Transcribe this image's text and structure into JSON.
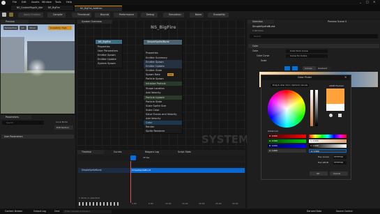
{
  "menu_bar": {
    "items": [
      "File",
      "Edit",
      "Assets",
      "Window",
      "Tools",
      "Help"
    ],
    "tabs": [
      "NS_CustomMsgvfx_Addit",
      "NS_BigFire",
      "NS_BigFire_Addition"
    ],
    "window_controls": [
      "_",
      "□",
      "×"
    ]
  },
  "toolbar": {
    "items": [
      "Save",
      "Browse",
      "Apply Emitters",
      "Compile",
      "Thumbnail",
      "Bounds",
      "Performance",
      "Debug",
      "Simulation",
      "Baker",
      "Scalability"
    ]
  },
  "preview": {
    "tab": "Preview",
    "buttons": [
      "Perspective",
      "Lit",
      "Show",
      "Scalability: High"
    ]
  },
  "system_overview": {
    "tab": "System Overview",
    "title": "NS_BigFire",
    "watermark": "SYSTEM",
    "system_node": {
      "title": "NS_BigFire",
      "rows": [
        "Properties",
        "User Parameters",
        "Emitter Spawn",
        "Emitter Update",
        "System Spawn",
        "System State"
      ]
    },
    "emitter_node": {
      "title": "SimpleSprite/Burst",
      "rows": [
        "Properties",
        "Emitter Summary",
        "Emitter Spawn",
        "Emitter Update",
        "Emitter State",
        "Spawn Rate",
        "Particle Spawn",
        "Initialize Particle",
        "Shape Location",
        "Add Velocity",
        "Particle Update",
        "Particle State",
        "Scale Sprite Size",
        "Scale Color",
        "Solve Forces and Velocity",
        "Add Velocity",
        "Color",
        "Render",
        "Sprite Renderer"
      ],
      "spawn_rate_value": "10.0",
      "scale_badge": "Linear",
      "sphere_badge": "Sphere"
    }
  },
  "parameters": {
    "tab": "Parameters",
    "search_placeholder": "Search",
    "user_param_section": "User Parameters",
    "user_param_btn": "Edit list",
    "add_section": "Edit Section",
    "show_local": "Local Mode"
  },
  "selection": {
    "tab": "Selection",
    "preview_scene": "Preview Scene S",
    "title": "SimpleSpriteBurst",
    "subtitle": "5 Particles",
    "search_placeholder": "Search",
    "color_label": "Color",
    "color_mode": "Color from Curve",
    "curve_label": "Color Curve",
    "curve_value": "Curve for Colors",
    "scale_label": "Scale",
    "tab_curves": "Curves",
    "tab_gradient": "Gradient"
  },
  "color_picker": {
    "title": "Color Picker",
    "mode_select": "Drag & drop color / Alpha to canvas",
    "srgb_preview": "sRGB Preview",
    "advanced": "Advanced",
    "fields_left": [
      "R: 0.000",
      "G: 0.000",
      "B: 0.000",
      "A: 1.000"
    ],
    "fields_right": [
      "H: 177.900",
      "S: 0.000",
      "V: 1.000",
      "A: 1.000"
    ],
    "hex_linear_label": "Hex Linear",
    "hex_linear_value": "FFFFFF00",
    "hex_srgb_label": "Hex sRGB",
    "hex_srgb_value": "FFFFFF00",
    "ok": "OK",
    "cancel": "Cancel",
    "colors": {
      "accent": "#0070e0",
      "swatch_top": "#ffa23a"
    }
  },
  "timeline": {
    "tabs": [
      "Timeline",
      "Curves",
      "Niagara Log",
      "Script Stats"
    ],
    "track_name": "SimpleSpriteBurst",
    "track_bar": "SimpleSpriteBurst",
    "fps": "30 fps",
    "time_labels": [
      "0.00",
      "5.00",
      "10.00",
      "15.00",
      "20.00",
      "25.00",
      "30.00"
    ],
    "status": "1 items (1 selected)"
  },
  "status_bar": {
    "items": [
      "Content Drawer",
      "Output Log",
      "Cmd",
      "Enter Console Command"
    ],
    "right": [
      "Derived Data",
      "Source Control"
    ]
  }
}
